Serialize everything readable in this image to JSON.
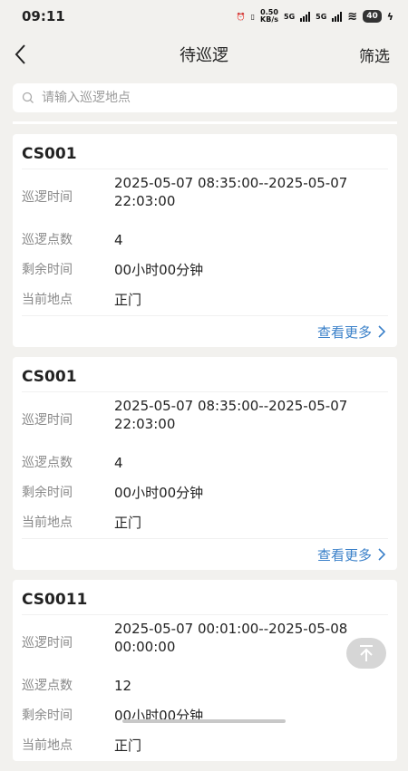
{
  "status": {
    "time": "09:11",
    "speed": "0.50\nKB/s",
    "net1": "5G",
    "net2": "5G",
    "battery": "40"
  },
  "nav": {
    "title": "待巡逻",
    "filter": "筛选"
  },
  "search": {
    "placeholder": "请输入巡逻地点"
  },
  "labels": {
    "time": "巡逻时间",
    "points": "巡逻点数",
    "remain": "剩余时间",
    "location": "当前地点",
    "more": "查看更多"
  },
  "cards": [
    {
      "id": "CS001",
      "time_line1": "2025-05-07 08:35:00--2025-05-07",
      "time_line2": "22:03:00",
      "points": "4",
      "remain": "00小时00分钟",
      "location": "正门"
    },
    {
      "id": "CS001",
      "time_line1": "2025-05-07 08:35:00--2025-05-07",
      "time_line2": "22:03:00",
      "points": "4",
      "remain": "00小时00分钟",
      "location": "正门"
    },
    {
      "id": "CS0011",
      "time_line1": "2025-05-07 00:01:00--2025-05-08",
      "time_line2": "00:00:00",
      "points": "12",
      "remain": "00小时00分钟",
      "location": "正门"
    }
  ]
}
